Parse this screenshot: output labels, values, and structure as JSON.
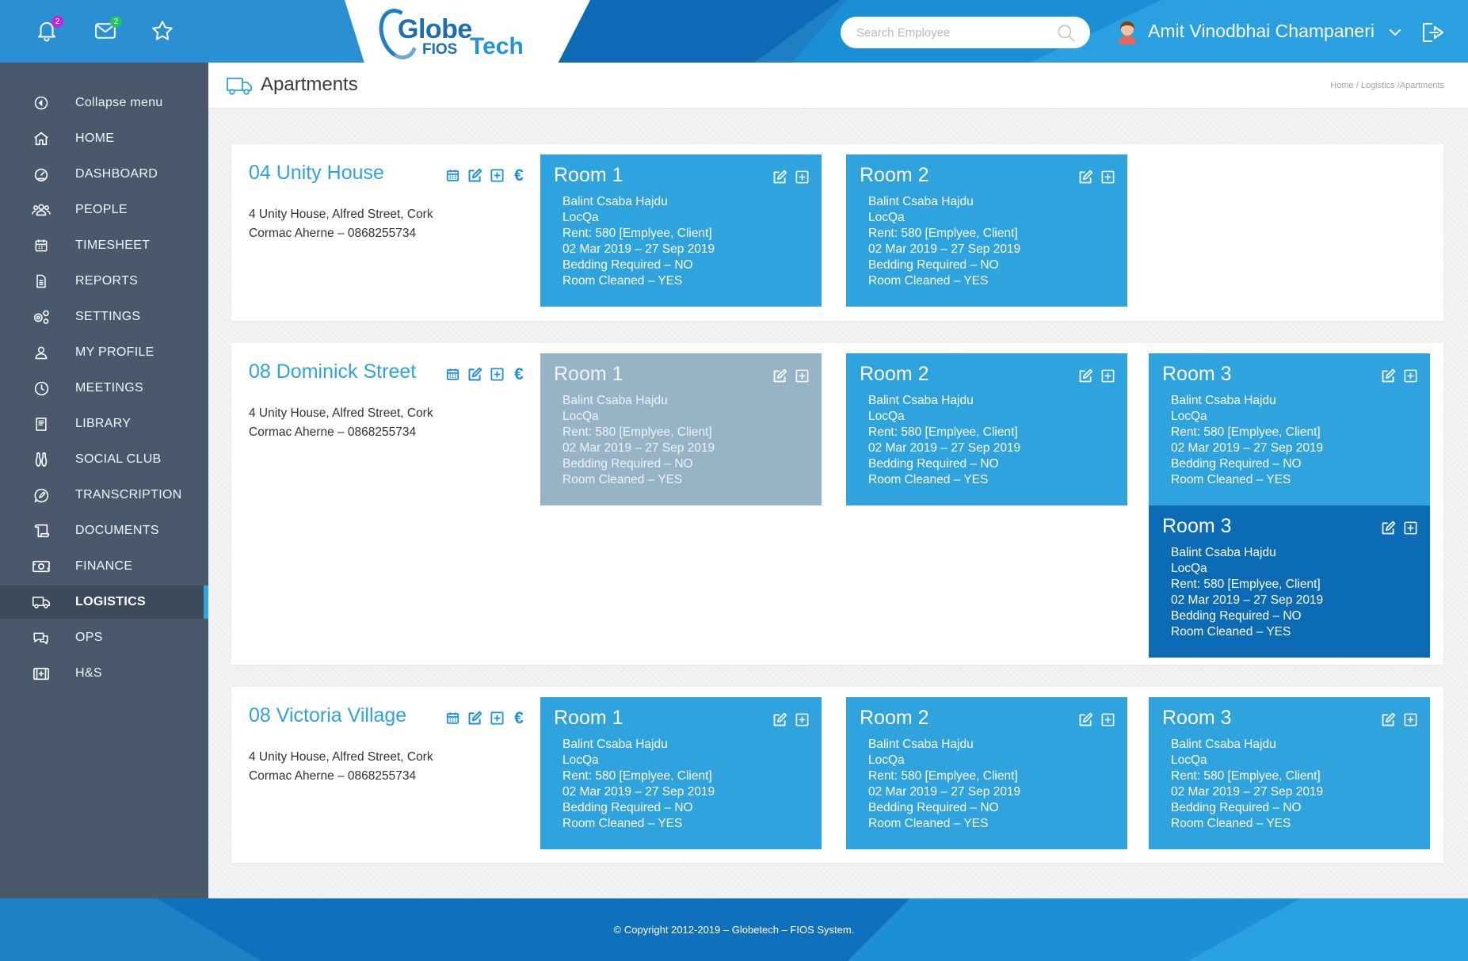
{
  "topbar": {
    "notifications_count": "2",
    "messages_count": "2",
    "logo": {
      "globe": "Globe",
      "fios": "FIOS",
      "tech": "Tech"
    },
    "search_placeholder": "Search Employee",
    "user_name": "Amit Vinodbhai Champaneri",
    "colors": {
      "bar": "#1f7fc5",
      "notif_badge": "#c026d3",
      "msg_badge": "#22c55e"
    }
  },
  "sidebar": {
    "items": [
      {
        "label": "Collapse menu",
        "icon": "chevron-circle-left-icon"
      },
      {
        "label": "HOME",
        "icon": "home-icon"
      },
      {
        "label": "DASHBOARD",
        "icon": "gauge-icon"
      },
      {
        "label": "PEOPLE",
        "icon": "people-icon"
      },
      {
        "label": "TIMESHEET",
        "icon": "calendar-icon"
      },
      {
        "label": "REPORTS",
        "icon": "document-icon"
      },
      {
        "label": "SETTINGS",
        "icon": "gears-icon"
      },
      {
        "label": "MY PROFILE",
        "icon": "user-icon"
      },
      {
        "label": "MEETINGS",
        "icon": "clock-icon"
      },
      {
        "label": "LIBRARY",
        "icon": "book-icon"
      },
      {
        "label": "SOCIAL CLUB",
        "icon": "bowling-pins-icon"
      },
      {
        "label": "TRANSCRIPTION",
        "icon": "chat-pen-icon"
      },
      {
        "label": "DOCUMENTS",
        "icon": "scroll-icon"
      },
      {
        "label": "FINANCE",
        "icon": "money-icon"
      },
      {
        "label": "LOGISTICS",
        "icon": "truck-icon"
      },
      {
        "label": "OPS",
        "icon": "chat-bubbles-icon"
      },
      {
        "label": "H&S",
        "icon": "medical-kit-icon"
      }
    ],
    "active_item": "LOGISTICS"
  },
  "header": {
    "title": "Apartments",
    "breadcrumb": {
      "home": "Home",
      "sep1": "/",
      "section": "Logistics",
      "sep2": "/",
      "page": "Apartments"
    }
  },
  "apartments": [
    {
      "name": "04 Unity House",
      "address": "4 Unity House, Alfred Street, Cork",
      "contact": "Cormac Aherne – 0868255734",
      "rooms": [
        {
          "title": "Room 1",
          "lines": [
            "Balint Csaba Hajdu",
            "LocQa",
            "Rent: 580 [Emplyee, Client]",
            "02 Mar 2019 – 27 Sep 2019",
            "Bedding Required – NO",
            "Room Cleaned – YES"
          ]
        },
        {
          "title": "Room 2",
          "lines": [
            "Balint Csaba Hajdu",
            "LocQa",
            "Rent: 580 [Emplyee, Client]",
            "02 Mar 2019 – 27 Sep 2019",
            "Bedding Required – NO",
            "Room Cleaned – YES"
          ]
        }
      ]
    },
    {
      "name": "08 Dominick Street",
      "address": "4 Unity House, Alfred Street, Cork",
      "contact": "Cormac Aherne – 0868255734",
      "rooms": [
        {
          "title": "Room 1",
          "lines": [
            "Balint Csaba Hajdu",
            "LocQa",
            "Rent: 580 [Emplyee, Client]",
            "02 Mar 2019 – 27 Sep 2019",
            "Bedding Required – NO",
            "Room Cleaned – YES"
          ]
        },
        {
          "title": "Room 2",
          "lines": [
            "Balint Csaba Hajdu",
            "LocQa",
            "Rent: 580 [Emplyee, Client]",
            "02 Mar 2019 – 27 Sep 2019",
            "Bedding Required – NO",
            "Room Cleaned – YES"
          ]
        },
        {
          "title": "Room 3",
          "lines": [
            "Balint Csaba Hajdu",
            "LocQa",
            "Rent: 580 [Emplyee, Client]",
            "02 Mar 2019 – 27 Sep 2019",
            "Bedding Required – NO",
            "Room Cleaned – YES"
          ]
        },
        {
          "title": "Room 3",
          "lines": [
            "Balint Csaba Hajdu",
            "LocQa",
            "Rent: 580 [Emplyee, Client]",
            "02 Mar 2019 – 27 Sep 2019",
            "Bedding Required – NO",
            "Room Cleaned – YES"
          ]
        }
      ]
    },
    {
      "name": "08 Victoria Village",
      "address": "4 Unity House, Alfred Street, Cork",
      "contact": "Cormac Aherne – 0868255734",
      "rooms": [
        {
          "title": "Room 1",
          "lines": [
            "Balint Csaba Hajdu",
            "LocQa",
            "Rent: 580 [Emplyee, Client]",
            "02 Mar 2019 – 27 Sep 2019",
            "Bedding Required – NO",
            "Room Cleaned – YES"
          ]
        },
        {
          "title": "Room 2",
          "lines": [
            "Balint Csaba Hajdu",
            "LocQa",
            "Rent: 580 [Emplyee, Client]",
            "02 Mar 2019 – 27 Sep 2019",
            "Bedding Required – NO",
            "Room Cleaned – YES"
          ]
        },
        {
          "title": "Room 3",
          "lines": [
            "Balint Csaba Hajdu",
            "LocQa",
            "Rent: 580 [Emplyee, Client]",
            "02 Mar 2019 – 27 Sep 2019",
            "Bedding Required – NO",
            "Room Cleaned – YES"
          ]
        }
      ]
    }
  ],
  "apartment_actions": {
    "euro_symbol": "€"
  },
  "colors": {
    "room": "#2ea3de",
    "room_inactive": "#97b4c6",
    "room_selected": "#0b6bb5",
    "accent": "#2ea3de",
    "sidebar": "#4a586b"
  },
  "footer": {
    "text": "© Copyright 2012-2019 – Globetech – FIOS System."
  }
}
